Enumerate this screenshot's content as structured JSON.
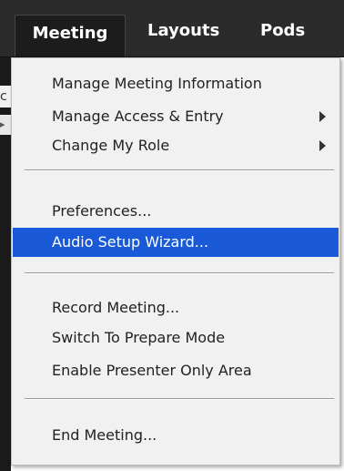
{
  "menubar": {
    "tabs": [
      {
        "label": "Meeting"
      },
      {
        "label": "Layouts"
      },
      {
        "label": "Pods"
      }
    ]
  },
  "background": {
    "left_letter": "c"
  },
  "menu": {
    "items": [
      {
        "label": "Manage Meeting Information"
      },
      {
        "label": "Manage Access & Entry"
      },
      {
        "label": "Change My Role"
      },
      {
        "label": "Preferences..."
      },
      {
        "label": "Audio Setup Wizard..."
      },
      {
        "label": "Record Meeting..."
      },
      {
        "label": "Switch To Prepare Mode"
      },
      {
        "label": "Enable Presenter Only Area"
      },
      {
        "label": "End Meeting..."
      }
    ],
    "highlight_color": "#1a5ad8"
  }
}
